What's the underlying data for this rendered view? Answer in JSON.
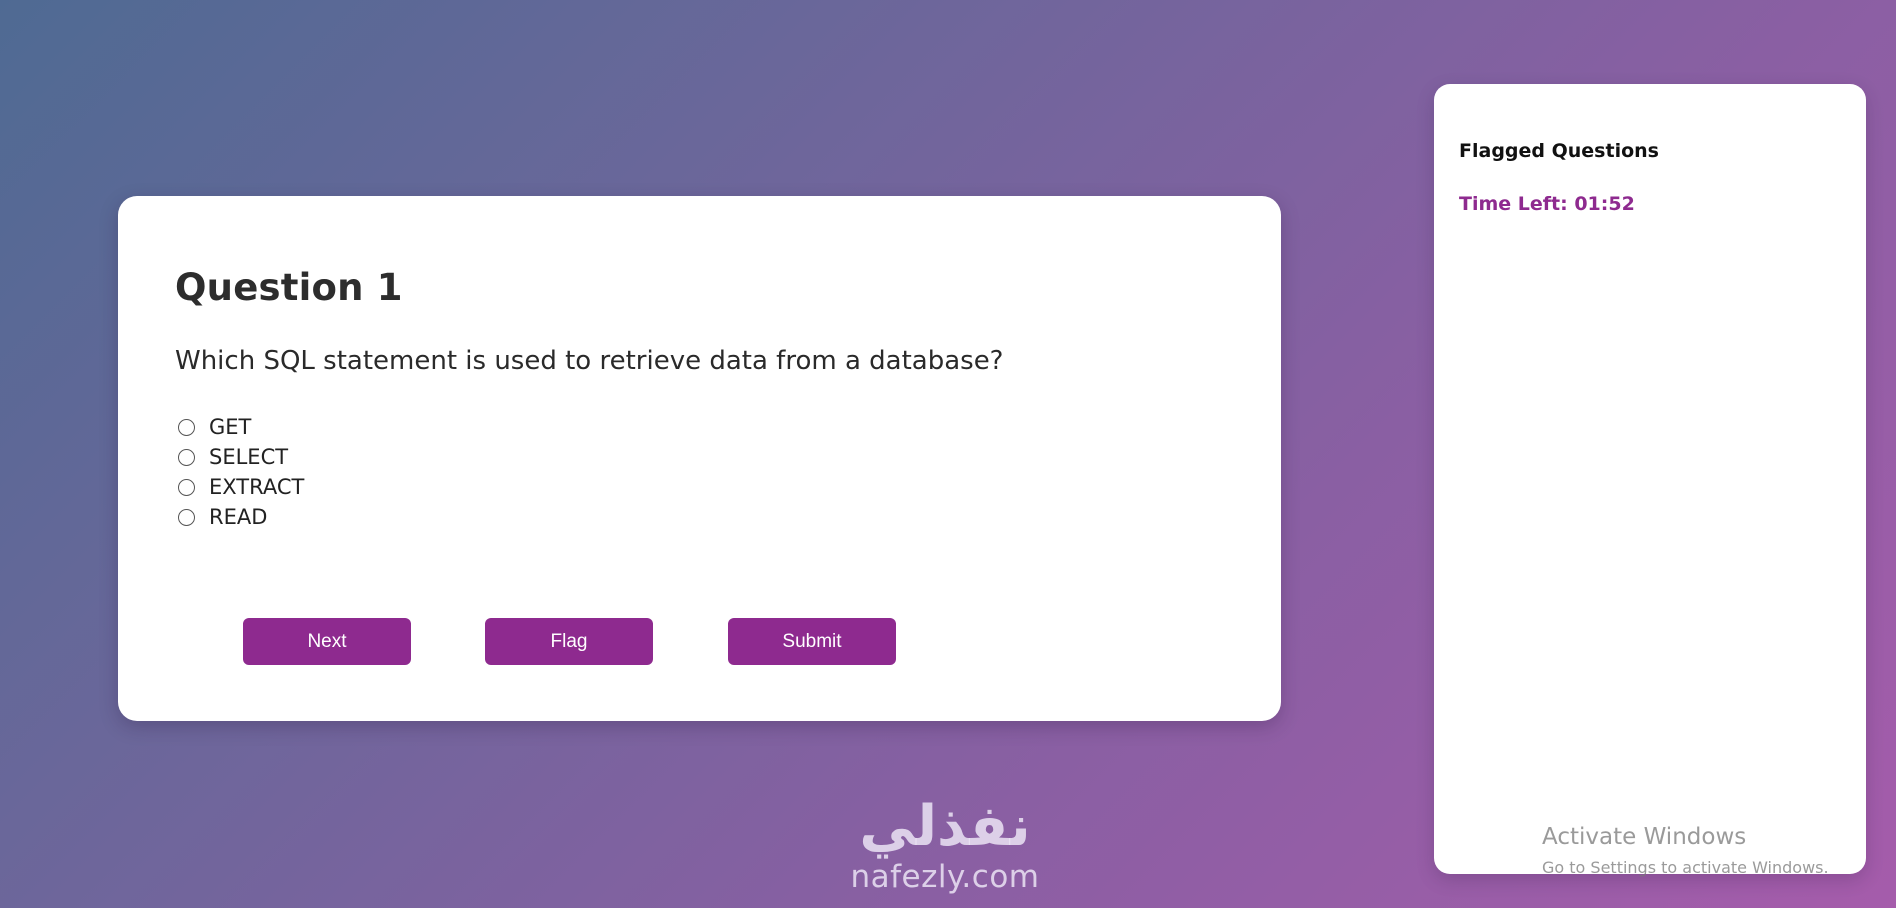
{
  "question": {
    "title": "Question 1",
    "text": "Which SQL statement is used to retrieve data from a database?",
    "options": [
      "GET",
      "SELECT",
      "EXTRACT",
      "READ"
    ]
  },
  "buttons": {
    "next": "Next",
    "flag": "Flag",
    "submit": "Submit"
  },
  "sidebar": {
    "title": "Flagged Questions",
    "timer": "Time Left: 01:52"
  },
  "watermark": {
    "arabic": "نفذلي",
    "latin": "nafezly.com"
  },
  "windows_notice": {
    "title": "Activate Windows",
    "subtitle": "Go to Settings to activate Windows."
  },
  "colors": {
    "accent": "#8e2a8f",
    "card": "#ffffff"
  }
}
